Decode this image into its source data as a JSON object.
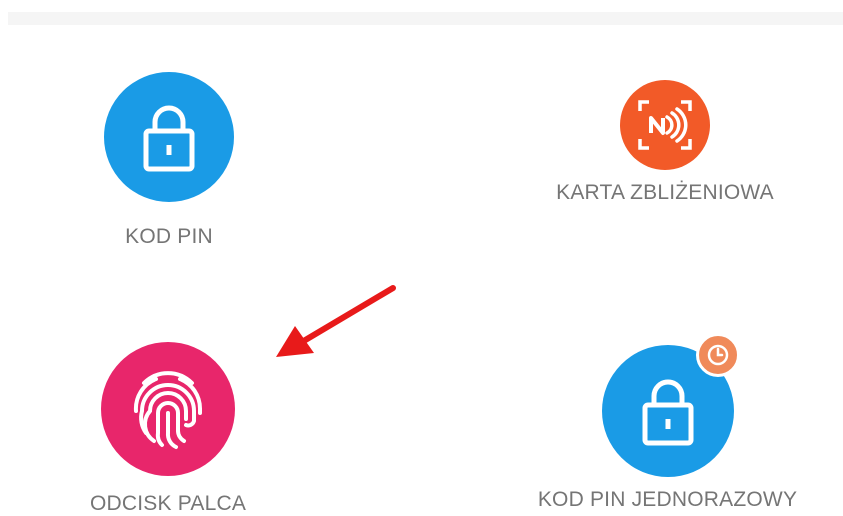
{
  "colors": {
    "pin_blue": "#1a9be6",
    "card_orange": "#f25a28",
    "finger_pink": "#e8266b",
    "badge_orange": "#f08a5a",
    "arrow_red": "#e81a1a",
    "label_gray": "#757575"
  },
  "methods": [
    {
      "label": "KOD PIN",
      "icon": "lock-icon",
      "color": "#1a9be6"
    },
    {
      "label": "KARTA ZBLIŻENIOWA",
      "icon": "nfc-card-icon",
      "color": "#f25a28"
    },
    {
      "label": "ODCISK PALCA",
      "icon": "fingerprint-icon",
      "color": "#e8266b"
    },
    {
      "label": "KOD PIN JEDNORAZOWY",
      "icon": "lock-icon",
      "color": "#1a9be6",
      "badge_icon": "clock-icon"
    }
  ],
  "annotation": {
    "icon": "red-arrow-icon"
  }
}
